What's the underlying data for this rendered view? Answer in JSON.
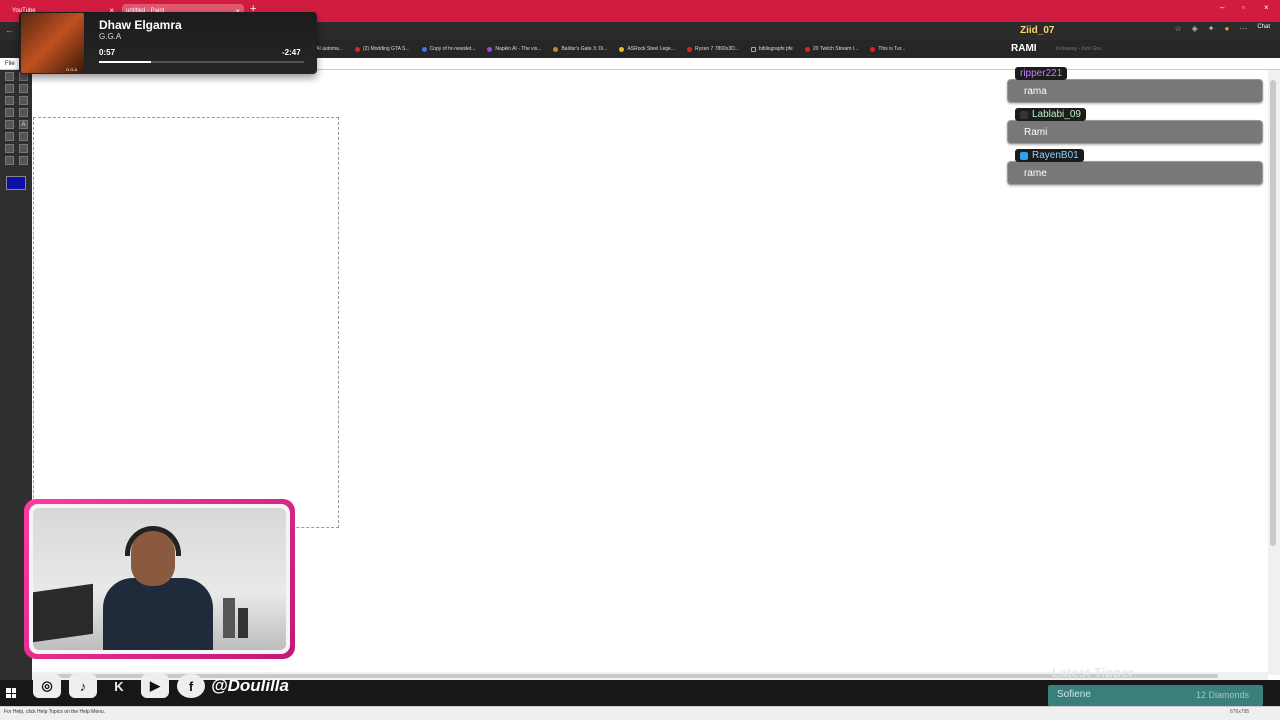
{
  "browser": {
    "tabs": [
      {
        "label": "YouTube"
      },
      {
        "label": "untitled - Paint"
      }
    ],
    "bookmarks": [
      "AI automa...",
      "(2) Modding GTA S...",
      "Copy of hr-newslet...",
      "Napkin AI - The vis...",
      "Baldur's Gate 3: Di...",
      "ASRock Steel Lege...",
      "Ryzen 7 7800x3D...",
      "bibliographi pfe",
      "20 Twitch Stream I...",
      "This is Tur..."
    ],
    "chat_button": "Chat"
  },
  "paint": {
    "menu_file": "File",
    "status_text": "For Help, click Help Topics on the Help Menu.",
    "canvas_size": "676x795",
    "primary_color": "#1010a8"
  },
  "music": {
    "title": "Dhaw Elgamra",
    "artist": "G.G.A",
    "elapsed": "0:57",
    "remaining": "-2:47",
    "progress": 0.255,
    "album_label": "G.G.A"
  },
  "chat": {
    "top_user": "Ziid_07",
    "top_message": "RAMI",
    "top_sub": "Kickaway - Kick Gre...",
    "messages": [
      {
        "user": "ripper221",
        "text": "rama",
        "color": "#c77dff"
      },
      {
        "user": "Lablabi_09",
        "text": "Rami",
        "color": "#b9f3c0"
      },
      {
        "user": "RayenB01",
        "text": "rame",
        "color": "#8fd0ff"
      }
    ]
  },
  "stream": {
    "handle": "@Doulilla",
    "latest_tipper_heading": "Latest Tipper",
    "tipper_name": "Sofiene",
    "tipper_amount": "12 Diamonds"
  }
}
